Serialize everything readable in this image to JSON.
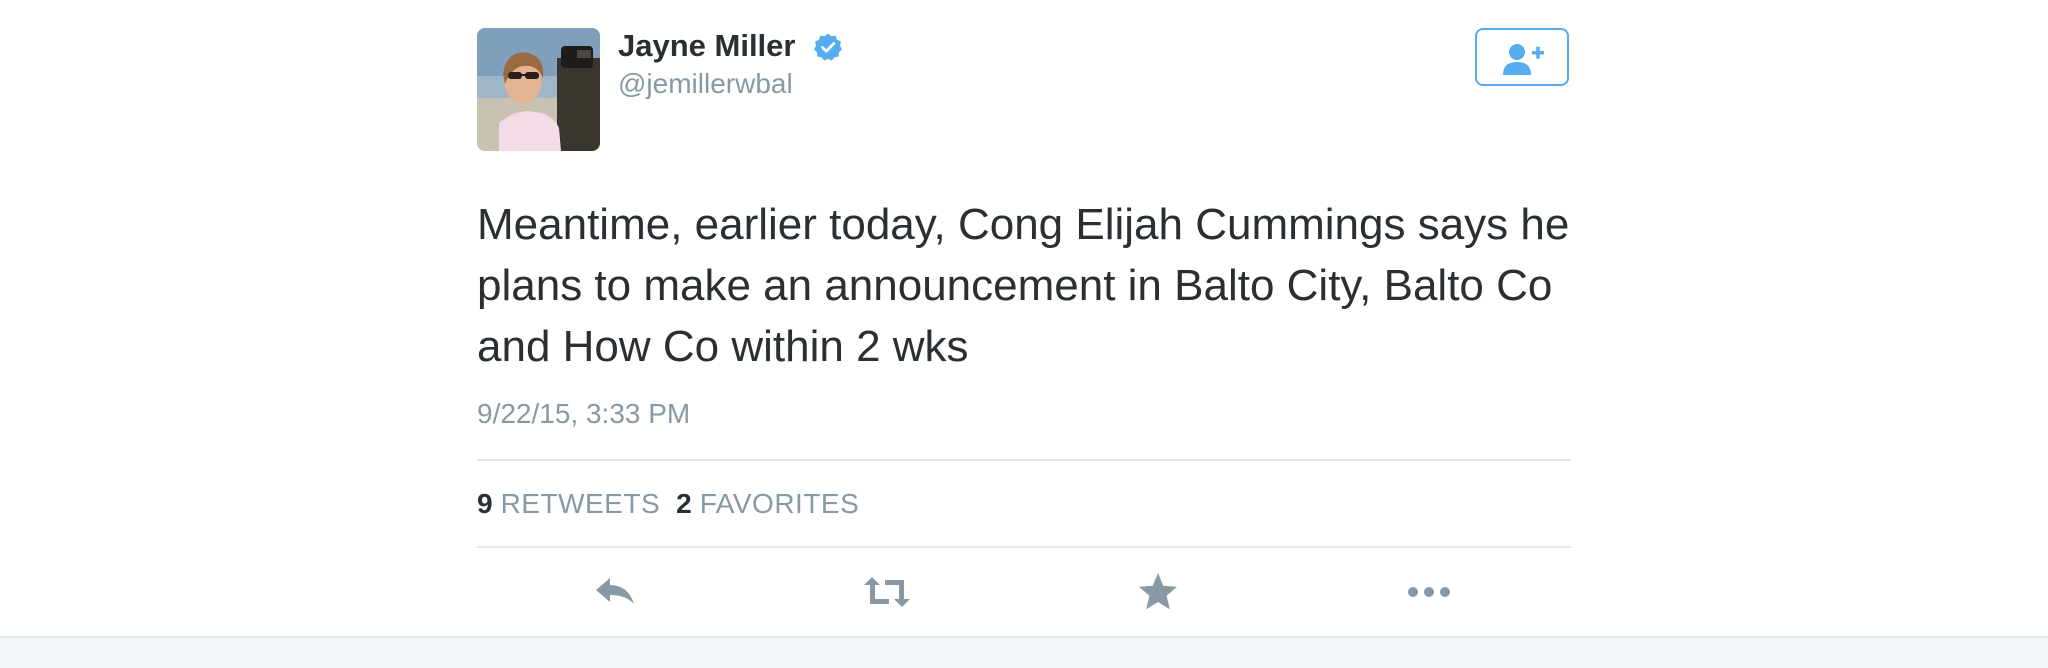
{
  "author": {
    "name": "Jayne Miller",
    "handle": "@jemillerwbal",
    "verified": true,
    "avatar_icon": "profile-photo"
  },
  "tweet": {
    "text": "Meantime, earlier today, Cong Elijah Cummings says he plans to make an announcement in Balto City, Balto Co and How Co within 2 wks",
    "timestamp": "9/22/15, 3:33 PM"
  },
  "stats": {
    "retweets_count": "9",
    "retweets_label": "RETWEETS",
    "favorites_count": "2",
    "favorites_label": "FAVORITES"
  },
  "actions": [
    {
      "icon": "reply-icon"
    },
    {
      "icon": "retweet-icon"
    },
    {
      "icon": "favorite-star-icon"
    },
    {
      "icon": "more-icon"
    }
  ],
  "follow_button": {
    "icon": "follow-user-plus-icon"
  },
  "colors": {
    "accent": "#55acee",
    "text": "#292f33",
    "muted": "#8899a6",
    "divider": "#e1e8ed",
    "footer": "#f5f8fa"
  }
}
